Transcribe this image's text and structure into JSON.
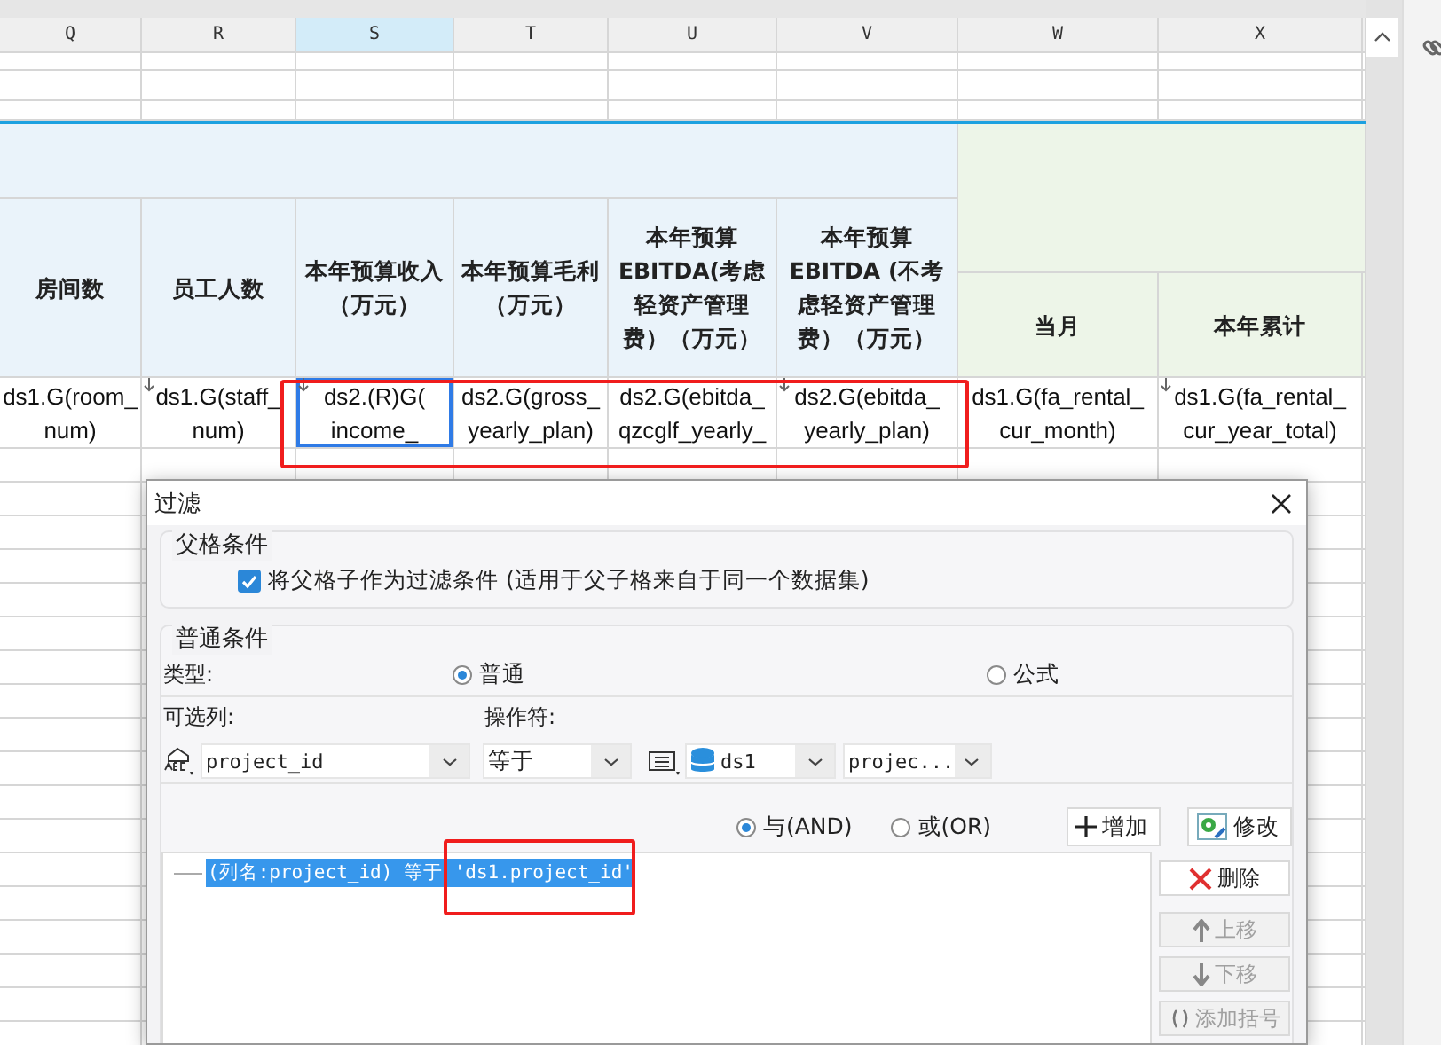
{
  "sheet": {
    "columns": [
      {
        "label": "Q",
        "selected": false
      },
      {
        "label": "R",
        "selected": false
      },
      {
        "label": "S",
        "selected": true
      },
      {
        "label": "T",
        "selected": false
      },
      {
        "label": "U",
        "selected": false
      },
      {
        "label": "V",
        "selected": false
      },
      {
        "label": "W",
        "selected": false
      },
      {
        "label": "X",
        "selected": false
      }
    ],
    "headers": [
      "房间数",
      "员工人数",
      "本年预算收入（万元）",
      "本年预算毛利（万元）",
      "本年预算EBITDA(考虑轻资产管理费）（万元）",
      "本年预算EBITDA (不考虑轻资产管理费）（万元）",
      "当月",
      "本年累计"
    ],
    "data_cells": [
      {
        "text": "ds1.G(room_num)",
        "expand_down": false,
        "selected": false
      },
      {
        "text": "ds1.G(staff_num)",
        "expand_down": true,
        "selected": false
      },
      {
        "text": "ds2.(R)G(income_",
        "expand_down": true,
        "selected": true
      },
      {
        "text": "ds2.G(gross_yearly_plan)",
        "expand_down": false,
        "selected": false
      },
      {
        "text": "ds2.G(ebitda_qzcglf_yearly_",
        "expand_down": false,
        "selected": false
      },
      {
        "text": "ds2.G(ebitda_yearly_plan)",
        "expand_down": true,
        "selected": false
      },
      {
        "text": "ds1.G(fa_rental_cur_month)",
        "expand_down": false,
        "selected": false
      },
      {
        "text": "ds1.G(fa_rental_cur_year_total)",
        "expand_down": true,
        "selected": false
      }
    ]
  },
  "dialog": {
    "title": "过滤",
    "parent_section": {
      "legend": "父格条件",
      "checkbox": {
        "label": "将父格子作为过滤条件 (适用于父子格来自于同一个数据集)",
        "checked": true
      }
    },
    "normal_section": {
      "legend": "普通条件",
      "type_label": "类型:",
      "type_options": [
        {
          "label": "普通",
          "selected": true
        },
        {
          "label": "公式",
          "selected": false
        }
      ],
      "column_label": "可选列:",
      "operator_label": "操作符:",
      "column_value": "project_id",
      "operator_value": "等于",
      "dataset_value": "ds1",
      "field_value": "projec...",
      "logic_options": [
        {
          "label": "与(AND)",
          "selected": true
        },
        {
          "label": "或(OR)",
          "selected": false
        }
      ],
      "actions": [
        {
          "label": "增加",
          "kind": "add"
        },
        {
          "label": "修改",
          "kind": "edit"
        }
      ],
      "conditions": [
        {
          "text": "(列名:project_id) 等于 'ds1.project_id'",
          "selected": true
        }
      ],
      "side_buttons": [
        {
          "label": "删除",
          "kind": "delete",
          "disabled": false
        },
        {
          "label": "上移",
          "kind": "up",
          "disabled": true
        },
        {
          "label": "下移",
          "kind": "down",
          "disabled": true
        },
        {
          "label": "添加括号",
          "kind": "bracket",
          "disabled": true
        }
      ]
    }
  }
}
